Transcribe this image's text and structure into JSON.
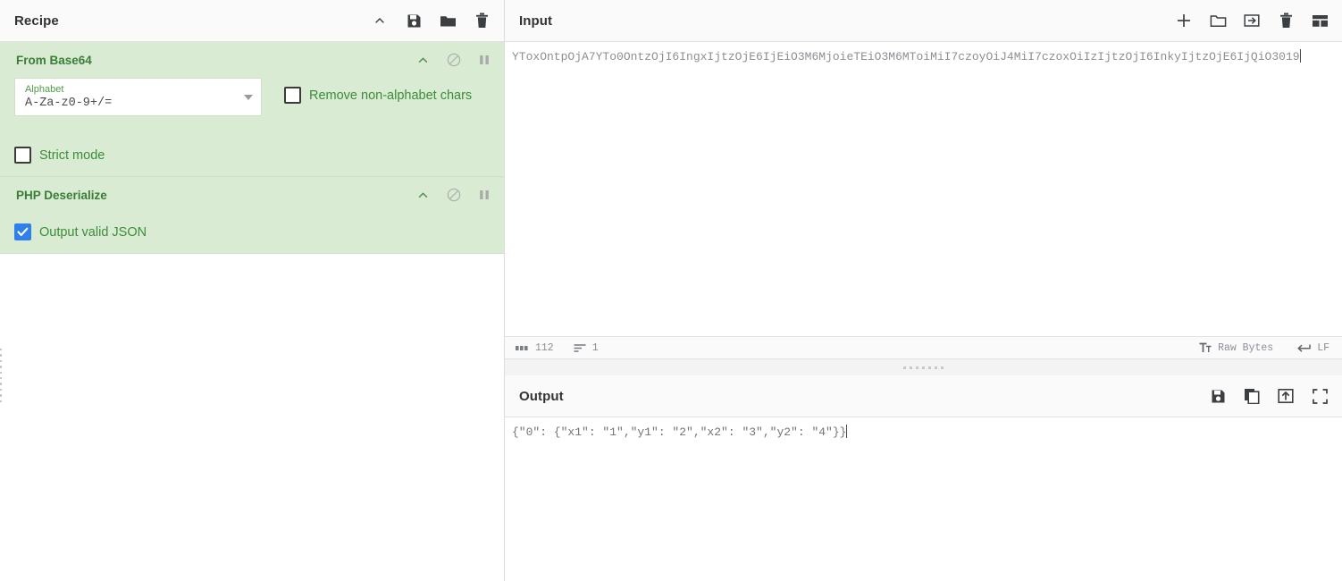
{
  "recipe": {
    "title": "Recipe",
    "header_icons": [
      {
        "name": "collapse-chevron-icon",
        "label": "^"
      },
      {
        "name": "save-recipe-icon",
        "label": "save"
      },
      {
        "name": "load-recipe-icon",
        "label": "folder"
      },
      {
        "name": "clear-recipe-icon",
        "label": "trash"
      }
    ],
    "operations": [
      {
        "title": "From Base64",
        "icons": [
          "chevron-up-icon",
          "disable-icon",
          "pause-icon"
        ],
        "alphabet_label": "Alphabet",
        "alphabet_value": "A-Za-z0-9+/=",
        "remove_non_alphabet_label": "Remove non-alphabet chars",
        "remove_non_alphabet_checked": false,
        "strict_mode_label": "Strict mode",
        "strict_mode_checked": false
      },
      {
        "title": "PHP Deserialize",
        "icons": [
          "chevron-up-icon",
          "disable-icon",
          "pause-icon"
        ],
        "output_valid_json_label": "Output valid JSON",
        "output_valid_json_checked": true
      }
    ]
  },
  "input": {
    "title": "Input",
    "value": "YToxOntpOjA7YTo0OntzOjI6IngxIjtzOjE6IjEiO3M6MjoieTEiO3M6MToiMiI7czoyOiJ4MiI7czoxOiIzIjtzOjI6InkyIjtzOjE6IjQiO3019",
    "toolbar_icons": [
      {
        "name": "add-input-tab-icon"
      },
      {
        "name": "open-folder-icon"
      },
      {
        "name": "open-file-as-input-icon"
      },
      {
        "name": "clear-input-icon"
      },
      {
        "name": "tab-layout-icon"
      }
    ],
    "status": {
      "length_icon": "abc-icon",
      "length": "112",
      "lines_icon": "lines-icon",
      "lines": "1",
      "encoding_icon": "font-icon",
      "encoding": "Raw Bytes",
      "line_ending_icon": "return-arrow-icon",
      "line_ending": "LF"
    }
  },
  "output": {
    "title": "Output",
    "value": "{\"0\": {\"x1\": \"1\",\"y1\": \"2\",\"x2\": \"3\",\"y2\": \"4\"}}",
    "toolbar_icons": [
      {
        "name": "save-output-icon"
      },
      {
        "name": "copy-output-icon"
      },
      {
        "name": "replace-input-with-output-icon"
      },
      {
        "name": "maximise-output-icon"
      }
    ]
  },
  "colors": {
    "operation_bg": "#d9ecd3",
    "operation_text": "#3a7d36",
    "checkbox_checked": "#2f80e8"
  }
}
